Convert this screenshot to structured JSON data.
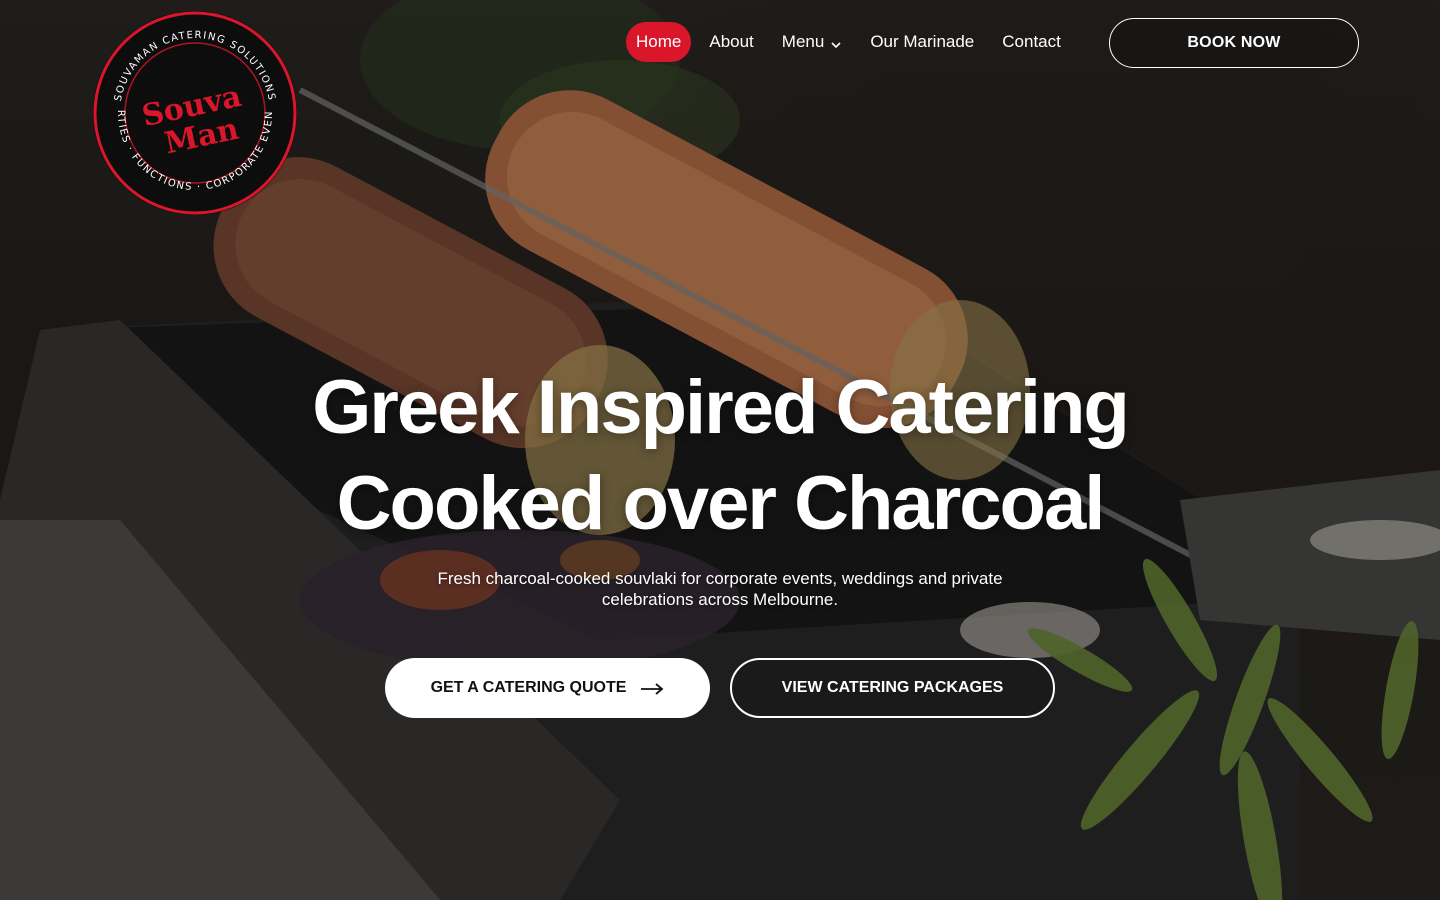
{
  "brand": {
    "logo_ring_text": "SOUVAMAN CATERING SOLUTIONS · CORPORATE EVENTS · FUNCTIONS · PARTIES",
    "logo_word_1": "Souva",
    "logo_word_2": "Man",
    "accent_color": "#d9162a"
  },
  "nav": {
    "items": [
      {
        "label": "Home",
        "active": true
      },
      {
        "label": "About"
      },
      {
        "label": "Menu",
        "icon": "chevron-down-icon"
      },
      {
        "label": "Our Marinade"
      },
      {
        "label": "Contact"
      }
    ],
    "book_label": "BOOK NOW"
  },
  "hero": {
    "title_line_1": "Greek Inspired Catering",
    "title_line_2": "Cooked over Charcoal",
    "subtitle": "Fresh charcoal-cooked souvlaki for corporate events, weddings and private celebrations across Melbourne.",
    "primary_cta": "GET A CATERING QUOTE",
    "primary_cta_icon": "arrow-right-icon",
    "secondary_cta": "VIEW CATERING PACKAGES"
  }
}
